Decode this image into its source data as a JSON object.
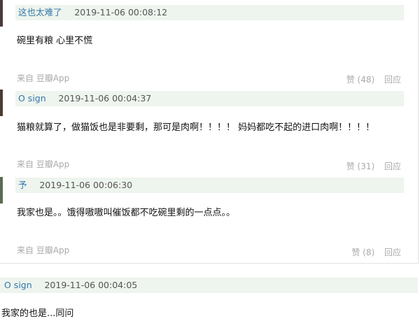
{
  "comments": [
    {
      "author": "这也太难了",
      "time": "2019-11-06 00:08:12",
      "text": "碗里有粮 心里不慌",
      "source": "来自 豆瓣App",
      "like_label": "赞 (48)",
      "reply_label": "回应"
    },
    {
      "author": "O sign",
      "time": "2019-11-06 00:04:37",
      "text": "猫粮就算了，做猫饭也是非要剩，那可是肉啊！！！！ 妈妈都吃不起的进口肉啊！！！！",
      "source": "来自 豆瓣App",
      "like_label": "赞 (31)",
      "reply_label": "回应"
    },
    {
      "author": "予",
      "time": "2019-11-06 00:06:30",
      "text": "我家也是。。饿得嗷嗷叫催饭都不吃碗里剩的一点点。。",
      "source": "来自 豆瓣App",
      "like_label": "赞 (8)",
      "reply_label": "回应"
    },
    {
      "author": "O sign",
      "time": "2019-11-06 00:04:05",
      "text": "我家的也是...同问"
    }
  ],
  "colors": {
    "header_bg": "#eef4ee",
    "author_link": "#3377aa",
    "muted_text": "#aaaaaa"
  }
}
